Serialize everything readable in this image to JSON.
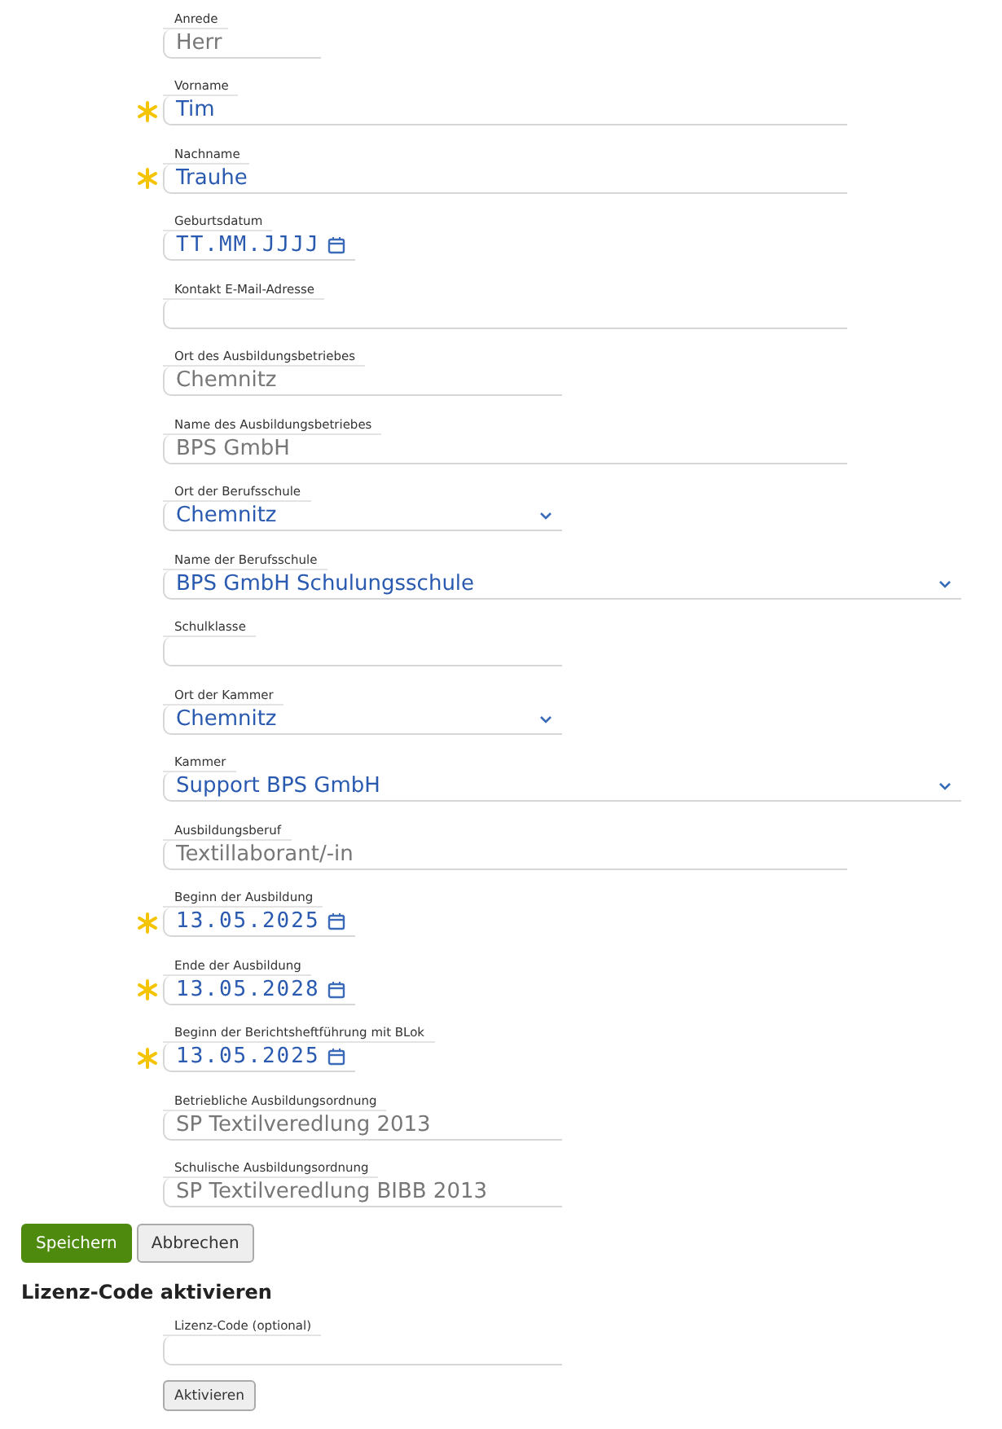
{
  "fields": [
    {
      "label": "Anrede",
      "kind": "text",
      "value": "Herr",
      "disabled": true,
      "required": false
    },
    {
      "label": "Vorname",
      "kind": "text",
      "value": "Tim",
      "disabled": false,
      "required": true
    },
    {
      "label": "Nachname",
      "kind": "text",
      "value": "Trauhe",
      "disabled": false,
      "required": true
    },
    {
      "label": "Geburtsdatum",
      "kind": "date",
      "placeholder": "TT.MM.JJJJ",
      "disabled": false,
      "required": false
    },
    {
      "label": "Kontakt E-Mail-Adresse",
      "kind": "text",
      "required": false
    },
    {
      "label": "Ort des Ausbildungsbetriebes",
      "kind": "text",
      "value": "Chemnitz",
      "disabled": true,
      "required": false
    },
    {
      "label": "Name des Ausbildungsbetriebes",
      "kind": "text",
      "value": "BPS GmbH",
      "disabled": true,
      "required": false
    },
    {
      "label": "Ort der Berufsschule",
      "kind": "select",
      "value": "Chemnitz",
      "disabled": false,
      "required": false
    },
    {
      "label": "Name der Berufsschule",
      "kind": "select",
      "value": "BPS GmbH Schulungsschule",
      "disabled": false,
      "required": false
    },
    {
      "label": "Schulklasse",
      "kind": "text",
      "required": false
    },
    {
      "label": "Ort der Kammer",
      "kind": "select",
      "value": "Chemnitz",
      "disabled": false,
      "required": false
    },
    {
      "label": "Kammer",
      "kind": "select",
      "value": "Support BPS GmbH",
      "disabled": false,
      "required": false
    },
    {
      "label": "Ausbildungsberuf",
      "kind": "text",
      "value": "Textillaborant/-in",
      "disabled": true,
      "required": false
    },
    {
      "label": "Beginn der Ausbildung",
      "kind": "date",
      "value": "13.05.2025",
      "disabled": false,
      "required": true
    },
    {
      "label": "Ende der Ausbildung",
      "kind": "date",
      "value": "13.05.2028",
      "disabled": false,
      "required": true
    },
    {
      "label": "Beginn der Berichtsheftführung mit BLok",
      "kind": "date",
      "value": "13.05.2025",
      "disabled": false,
      "required": true
    },
    {
      "label": "Betriebliche Ausbildungsordnung",
      "kind": "text",
      "value": "SP Textilveredlung 2013",
      "disabled": true,
      "required": false
    },
    {
      "label": "Schulische Ausbildungsordnung",
      "kind": "text",
      "value": "SP Textilveredlung BIBB 2013",
      "disabled": true,
      "required": false
    }
  ],
  "buttons": [
    {
      "label": "Speichern",
      "kind": "primary"
    },
    {
      "label": "Abbrechen",
      "kind": "secondary"
    }
  ],
  "license": {
    "heading": "Lizenz-Code aktivieren",
    "label": "Lizenz-Code (optional)",
    "button": "Aktivieren"
  }
}
